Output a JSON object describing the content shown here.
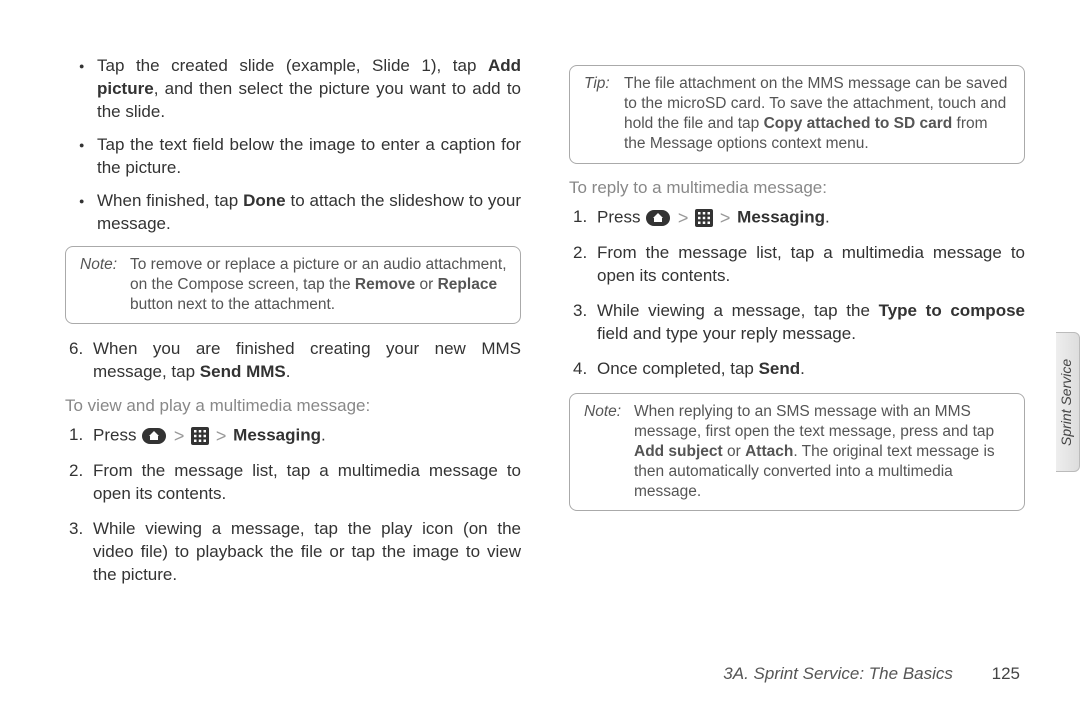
{
  "left": {
    "bullets": [
      {
        "pre": "Tap the created slide (example, Slide 1), tap ",
        "bold": "Add picture",
        "post": ", and then select the picture you want to add to the slide."
      },
      {
        "pre": "Tap the text field below the image to enter a caption for the picture."
      },
      {
        "pre": "When finished, tap ",
        "bold": "Done",
        "post": " to attach the slideshow to your message."
      }
    ],
    "note": {
      "label": "Note:",
      "pre": "To remove or replace a picture or an audio attachment, on the Compose screen, tap the ",
      "b1": "Remove",
      "mid": " or ",
      "b2": "Replace",
      "post": " button next to the attachment."
    },
    "step6": {
      "num": "6.",
      "pre": "When you are finished creating your new MMS message, tap ",
      "bold": "Send MMS",
      "post": "."
    },
    "heading": "To view and play a multimedia message:",
    "steps": [
      {
        "num": "1.",
        "pre": "Press ",
        "icons": true,
        "bold": "Messaging",
        "post": "."
      },
      {
        "num": "2.",
        "pre": "From the message list, tap a multimedia message to open its contents."
      },
      {
        "num": "3.",
        "pre": "While viewing a message, tap the play icon (on the video file) to playback the file or tap the image to view the picture."
      }
    ]
  },
  "right": {
    "tip": {
      "label": "Tip:",
      "pre": "The file attachment on the MMS message can be saved to the microSD card. To save the attachment, touch and hold the file and tap ",
      "b1": "Copy attached to SD card",
      "post": " from the Message options context menu."
    },
    "heading": "To reply to a multimedia message:",
    "steps": [
      {
        "num": "1.",
        "pre": "Press ",
        "icons": true,
        "bold": "Messaging",
        "post": "."
      },
      {
        "num": "2.",
        "pre": "From the message list, tap a multimedia message to open its contents."
      },
      {
        "num": "3.",
        "pre": "While viewing a message, tap the ",
        "bold": "Type to compose",
        "post": " field and type your reply message."
      },
      {
        "num": "4.",
        "pre": "Once completed, tap ",
        "bold": "Send",
        "post": "."
      }
    ],
    "note": {
      "label": "Note:",
      "pre": "When replying to an SMS message with an MMS message, first open the text message, press and tap ",
      "b1": "Add subject",
      "mid": " or ",
      "b2": "Attach",
      "post": ". The original text message is then automatically converted into a multimedia message."
    }
  },
  "footer": {
    "title": "3A. Sprint Service: The Basics",
    "page": "125"
  },
  "sidetab": "Sprint Service",
  "gt": ">"
}
